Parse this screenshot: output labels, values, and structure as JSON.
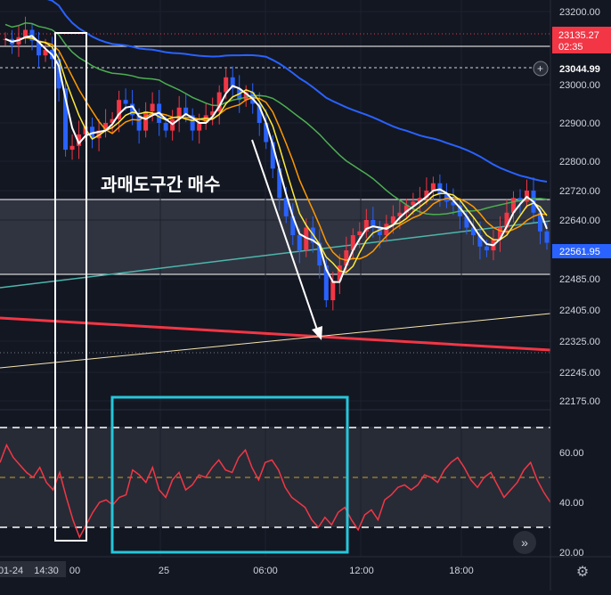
{
  "chart_data": [
    {
      "type": "candlestick",
      "title": "",
      "y_axis_ticks": [
        "23200.00",
        "23000.00",
        "22900.00",
        "22800.00",
        "22720.00",
        "22640.00",
        "22485.00",
        "22405.00",
        "22325.00",
        "22245.00",
        "22175.00"
      ],
      "price_tags": [
        {
          "label": "23135.27",
          "sub": "02:35",
          "color": "#f23645"
        },
        {
          "label": "23044.99",
          "color": "#131722"
        },
        {
          "label": "22561.95",
          "color": "#2962ff"
        }
      ],
      "x_axis_ticks": [
        "01-24",
        "14:30",
        "00",
        "25",
        "06:00",
        "12:00",
        "18:00"
      ],
      "annotation": "과매도구간 매수",
      "close": [
        23125,
        23110,
        23130,
        23150,
        23120,
        23080,
        23095,
        23070,
        22990,
        22830,
        22840,
        22870,
        22890,
        22860,
        22880,
        22900,
        22910,
        22960,
        22950,
        22920,
        22880,
        22930,
        22950,
        22900,
        22880,
        22910,
        22940,
        22920,
        22880,
        22900,
        22920,
        22930,
        22980,
        23020,
        22990,
        22960,
        22980,
        22950,
        22900,
        22850,
        22780,
        22700,
        22650,
        22600,
        22560,
        22620,
        22580,
        22520,
        22430,
        22480,
        22520,
        22560,
        22600,
        22610,
        22640,
        22620,
        22600,
        22630,
        22650,
        22660,
        22680,
        22690,
        22700,
        22720,
        22740,
        22710,
        22690,
        22680,
        22650,
        22620,
        22600,
        22570,
        22560,
        22590,
        22620,
        22660,
        22700,
        22690,
        22720,
        22660,
        22610,
        22580
      ]
    },
    {
      "type": "line",
      "title": "",
      "y_axis_ticks": [
        "60.00",
        "40.00",
        "20.00"
      ],
      "ylim": [
        20,
        70
      ],
      "levels": [
        70,
        50,
        30
      ],
      "values": [
        56,
        63,
        58,
        55,
        52,
        50,
        54,
        48,
        45,
        52,
        42,
        33,
        26,
        31,
        36,
        40,
        41,
        39,
        42,
        43,
        53,
        51,
        48,
        54,
        45,
        42,
        49,
        52,
        45,
        47,
        51,
        50,
        54,
        57,
        53,
        52,
        58,
        61,
        54,
        49,
        56,
        57,
        53,
        46,
        42,
        40,
        38,
        33,
        30,
        34,
        31,
        36,
        38,
        33,
        29,
        35,
        37,
        33,
        41,
        43,
        46,
        47,
        45,
        47,
        51,
        50,
        48,
        53,
        56,
        58,
        54,
        49,
        46,
        50,
        52,
        47,
        42,
        45,
        48,
        53,
        56,
        49,
        44,
        40
      ]
    }
  ],
  "ui": {
    "expand_icon": "double-chevron-right-icon",
    "settings_icon": "gear-icon",
    "add_alert_icon": "plus-circle-icon"
  }
}
